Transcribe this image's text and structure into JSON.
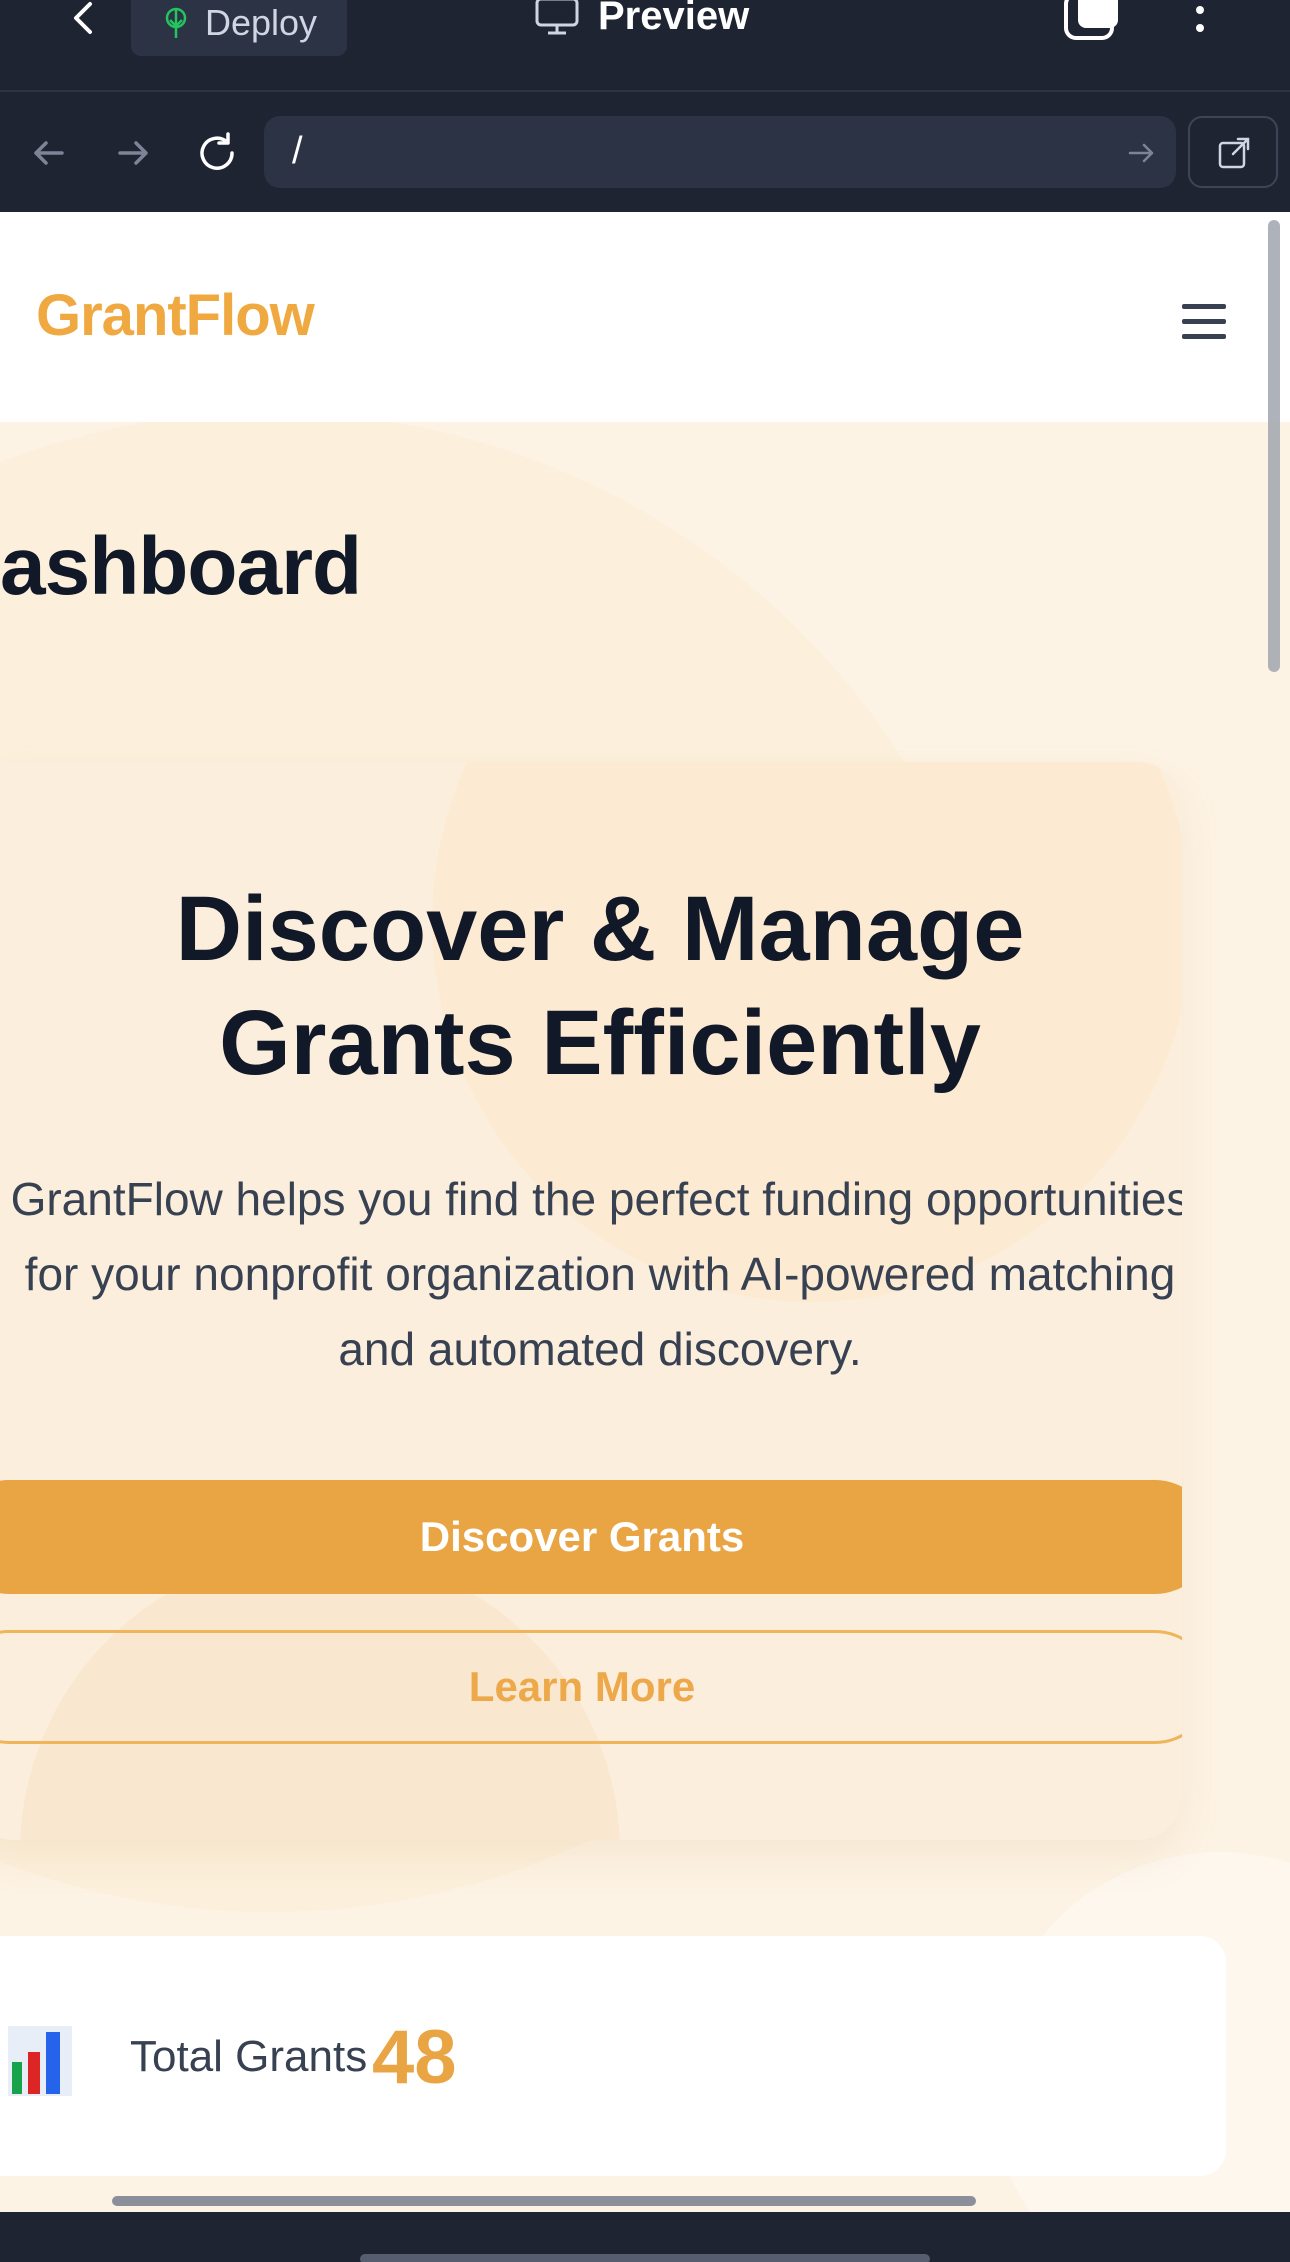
{
  "browser": {
    "deploy_label": "Deploy",
    "preview_label": "Preview",
    "url": "/"
  },
  "site": {
    "brand": "GrantFlow",
    "page_heading": "ashboard"
  },
  "hero": {
    "title": "Discover & Manage Grants Efficiently",
    "description": "GrantFlow helps you find the perfect funding opportunities for your nonprofit organization with AI-powered matching and automated discovery.",
    "primary_button": "Discover Grants",
    "secondary_button": "Learn More"
  },
  "stats": {
    "total_grants_label": "Total Grants",
    "total_grants_value": "48",
    "icon": "bar-chart-icon"
  },
  "colors": {
    "accent": "#e9a443",
    "brand": "#f0a840",
    "chrome": "#1f2433"
  }
}
